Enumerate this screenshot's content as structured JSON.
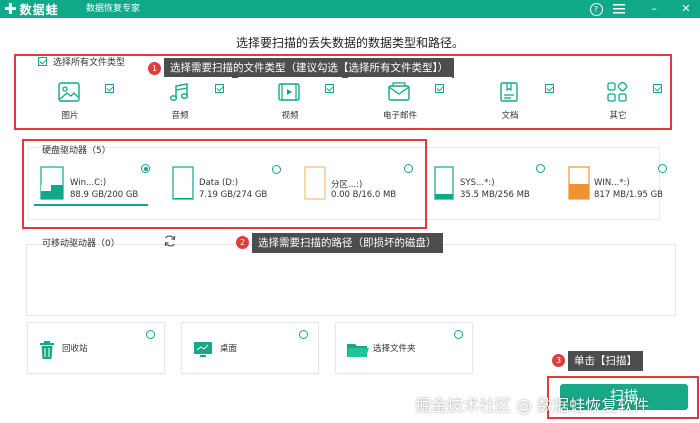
{
  "titlebar": {
    "logo": "数据蛙",
    "subtitle": "数据恢复专家",
    "help_icon": "?",
    "minimize_icon": "–",
    "close_icon": "✕"
  },
  "heading": "选择要扫描的丢失数据的数据类型和路径。",
  "file_types": {
    "select_all_label": "选择所有文件类型",
    "items": [
      {
        "label": "图片",
        "icon": "image-icon"
      },
      {
        "label": "音频",
        "icon": "music-icon"
      },
      {
        "label": "视频",
        "icon": "video-icon"
      },
      {
        "label": "电子邮件",
        "icon": "email-icon"
      },
      {
        "label": "文档",
        "icon": "document-icon"
      },
      {
        "label": "其它",
        "icon": "other-icon"
      }
    ]
  },
  "callouts": {
    "c1": {
      "num": "1",
      "text": "选择需要扫描的文件类型（建议勾选【选择所有文件类型】）"
    },
    "c2": {
      "num": "2",
      "text": "选择需要扫描的路径（即损坏的磁盘）"
    },
    "c3": {
      "num": "3",
      "text": "单击【扫描】"
    }
  },
  "hard_drives": {
    "title": "硬盘驱动器（5）",
    "items": [
      {
        "name": "Win...C:)",
        "size": "88.9 GB/200 GB",
        "selected": true,
        "used_fraction": 0.44
      },
      {
        "name": "Data (D:)",
        "size": "7.19 GB/274 GB",
        "selected": false,
        "used_fraction": 0.03
      },
      {
        "name": "分区...:)",
        "size": "0.00  B/16.0 MB",
        "selected": false,
        "used_fraction": 0
      },
      {
        "name": "SYS...*:)",
        "size": "35.5 MB/256 MB",
        "selected": false,
        "used_fraction": 0.14
      },
      {
        "name": "WIN...*:)",
        "size": "817 MB/1.95 GB",
        "selected": false,
        "used_fraction": 0.42
      }
    ]
  },
  "removable": {
    "title": "可移动驱动器（0）"
  },
  "locations": [
    {
      "label": "回收站",
      "icon": "recycle-bin-icon"
    },
    {
      "label": "桌面",
      "icon": "desktop-icon"
    },
    {
      "label": "选择文件夹",
      "icon": "folder-icon"
    }
  ],
  "scan_button": "扫描",
  "watermark": "掘金技术社区 @ 数据蛙恢复软件",
  "colors": {
    "accent": "#0fa889",
    "highlight": "#e23b3b",
    "callout_bg": "#4d4d4d",
    "warning": "#f0922f"
  }
}
